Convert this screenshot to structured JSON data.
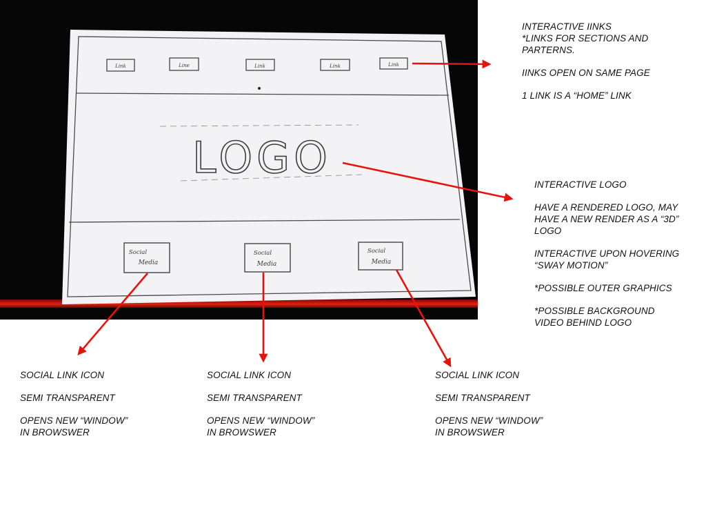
{
  "sketch": {
    "nav_links": [
      "Link",
      "Line",
      "Link",
      "Link",
      "Link"
    ],
    "logo_text": "LOGO",
    "social_boxes": [
      {
        "line1": "Social",
        "line2": "Media"
      },
      {
        "line1": "Social",
        "line2": "Media"
      },
      {
        "line1": "Social",
        "line2": "Media"
      }
    ]
  },
  "notes": {
    "links": {
      "title": "INTERACTIVE IINKS",
      "lines": [
        "*LINKS FOR SECTIONS AND",
        "PARTERNS."
      ],
      "open_same_page": "IINKS OPEN ON SAME PAGE",
      "home_link": "1 LINK IS A “HOME” LINK"
    },
    "logo": {
      "title": "INTERACTIVE LOGO",
      "render": [
        "HAVE A RENDERED LOGO, MAY",
        "HAVE A NEW RENDER AS A “3D”",
        "LOGO"
      ],
      "hover": [
        "INTERACTIVE UPON HOVERING",
        "“SWAY MOTION”"
      ],
      "outer": "*POSSIBLE OUTER GRAPHICS",
      "video": [
        "*POSSIBLE BACKGROUND",
        "VIDEO BEHIND LOGO"
      ]
    },
    "social": [
      {
        "title": "SOCIAL LINK ICON",
        "opacity": "SEMI TRANSPARENT",
        "opens": [
          "OPENS NEW “WINDOW”",
          "IN BROWSWER"
        ]
      },
      {
        "title": "SOCIAL LINK ICON",
        "opacity": "SEMI TRANSPARENT",
        "opens": [
          "OPENS NEW “WINDOW”",
          "IN BROWSWER"
        ]
      },
      {
        "title": "SOCIAL LINK ICON",
        "opacity": "SEMI TRANSPARENT",
        "opens": [
          "OPENS NEW “WINDOW”",
          "IN BROWSWER"
        ]
      }
    ]
  },
  "colors": {
    "arrow": "#e8120c",
    "paper": "#f3f2f5",
    "pencil": "#3a3a3a"
  }
}
